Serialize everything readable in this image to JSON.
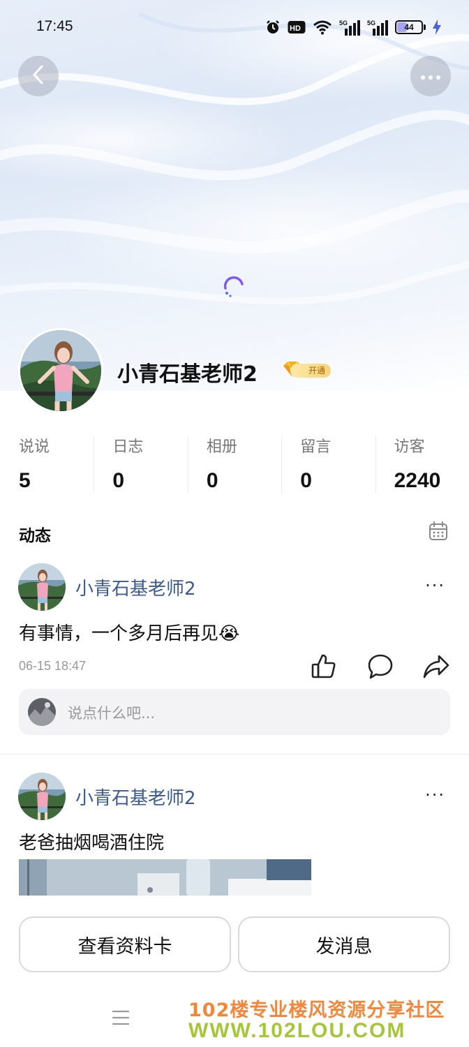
{
  "status_bar": {
    "time": "17:45",
    "icons": [
      "alarm-icon",
      "hd-icon",
      "wifi-icon",
      "5g-signal-icon",
      "5g-signal-icon",
      "battery-icon",
      "charging-icon"
    ],
    "hd_label": "HD",
    "network_1": "5G",
    "network_2": "5G",
    "battery_level": 44,
    "battery_label": "44"
  },
  "header": {
    "back_icon": "chevron-left-icon",
    "more_icon": "more-horizontal-icon"
  },
  "profile": {
    "name": "小青石基老师2",
    "vip_badge": "开通",
    "stats": [
      {
        "label": "说说",
        "value": "5"
      },
      {
        "label": "日志",
        "value": "0"
      },
      {
        "label": "相册",
        "value": "0"
      },
      {
        "label": "留言",
        "value": "0"
      },
      {
        "label": "访客",
        "value": "2240"
      }
    ]
  },
  "feed": {
    "title": "动态",
    "calendar_icon": "calendar-icon",
    "posts": [
      {
        "author": "小青石基老师2",
        "more": "···",
        "text": "有事情，一个多月后再见😭",
        "time": "06-15 18:47",
        "comment_placeholder": "说点什么吧..."
      },
      {
        "author": "小青石基老师2",
        "more": "···",
        "text": "老爸抽烟喝酒住院"
      }
    ]
  },
  "bottom_actions": {
    "profile_card": "查看资料卡",
    "send_message": "发消息"
  },
  "watermark": {
    "line1": "102楼专业楼风资源分享社区",
    "line2": "WWW.102LOU.COM"
  },
  "colors": {
    "author": "#3b5a91",
    "spinner": "#7c5cf0",
    "watermark_orange": "#f2873a",
    "watermark_green": "#a6c63a"
  }
}
